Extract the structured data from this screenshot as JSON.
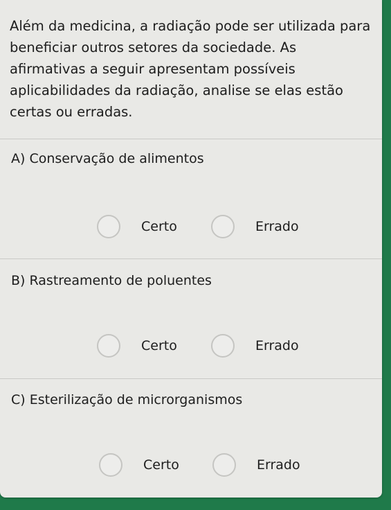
{
  "prompt": "Além da medicina, a radiação pode ser utilizada para beneficiar outros setores da sociedade. As afirmativas a seguir apresentam possíveis aplicabilidades da radiação, analise se elas estão certas ou erradas.",
  "questions": [
    {
      "label": "A) Conservação de alimentos",
      "options": [
        "Certo",
        "Errado"
      ]
    },
    {
      "label": "B) Rastreamento de poluentes",
      "options": [
        "Certo",
        "Errado"
      ]
    },
    {
      "label": "C) Esterilização de microrganismos",
      "options": [
        "Certo",
        "Errado"
      ]
    }
  ],
  "colors": {
    "background": "#1f7a4a",
    "card": "#e9e9e6",
    "text": "#1d1d1d",
    "radio_border": "#c5c5c2"
  }
}
